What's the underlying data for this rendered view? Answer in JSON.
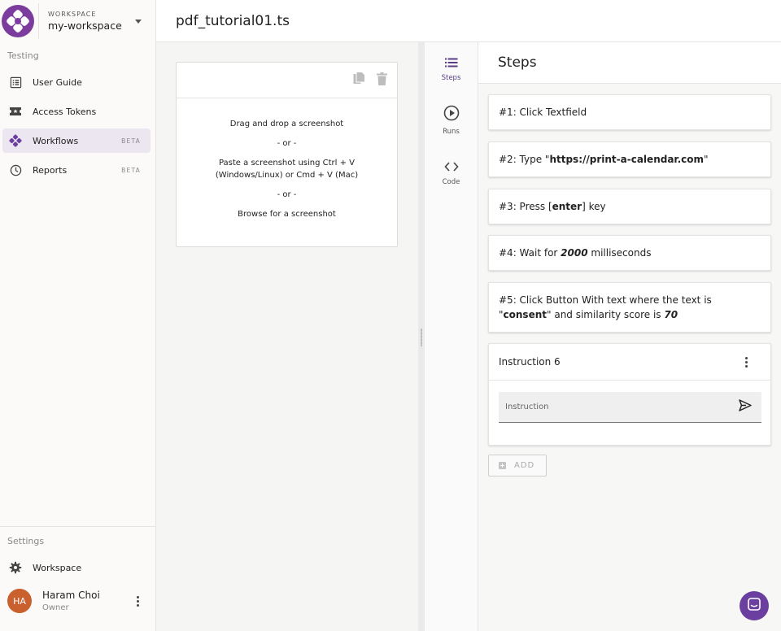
{
  "workspace": {
    "kicker": "WORKSPACE",
    "name": "my-workspace",
    "brand_color": "#7b3c9e"
  },
  "sidebar": {
    "testing_label": "Testing",
    "items": [
      {
        "label": "User Guide",
        "icon": "list-icon",
        "badge": ""
      },
      {
        "label": "Access Tokens",
        "icon": "ticket-icon",
        "badge": ""
      },
      {
        "label": "Workflows",
        "icon": "gamepad-icon",
        "badge": "BETA",
        "active": true
      },
      {
        "label": "Reports",
        "icon": "clock-icon",
        "badge": "BETA"
      }
    ],
    "settings_label": "Settings",
    "settings_item": {
      "label": "Workspace",
      "icon": "gear-icon"
    },
    "user": {
      "initials": "HA",
      "name": "Haram Choi",
      "role": "Owner"
    }
  },
  "header": {
    "file_title": "pdf_tutorial01.ts"
  },
  "screenshot": {
    "line1": "Drag and drop a screenshot",
    "or1": "- or -",
    "line2": "Paste a screenshot using Ctrl + V",
    "line3": "(Windows/Linux) or Cmd + V (Mac)",
    "or2": "- or -",
    "line4": "Browse for a screenshot"
  },
  "rail": {
    "tabs": [
      {
        "label": "Steps",
        "icon": "list-icon",
        "active": true
      },
      {
        "label": "Runs",
        "icon": "play-circle-icon"
      },
      {
        "label": "Code",
        "icon": "code-icon"
      }
    ]
  },
  "steps": {
    "title": "Steps",
    "items": [
      {
        "parts": [
          "#1: Click Textfield"
        ]
      },
      {
        "parts": [
          "#2: Type \"",
          "https://print-a-calendar.com",
          "\""
        ]
      },
      {
        "parts": [
          "#3: Press [",
          "enter",
          "] key"
        ]
      },
      {
        "parts": [
          "#4: Wait for ",
          "2000",
          " milliseconds"
        ]
      },
      {
        "parts": [
          "#5: Click Button With text where the text is \"",
          "consent",
          "\" and similarity score is ",
          "70"
        ]
      }
    ],
    "instruction": {
      "title": "Instruction 6",
      "placeholder": "Instruction",
      "value": ""
    },
    "add_label": "ADD"
  },
  "colors": {
    "accent": "#6b3fa0",
    "active_nav_bg": "#ebe6f0",
    "avatar": "#c9602e"
  }
}
